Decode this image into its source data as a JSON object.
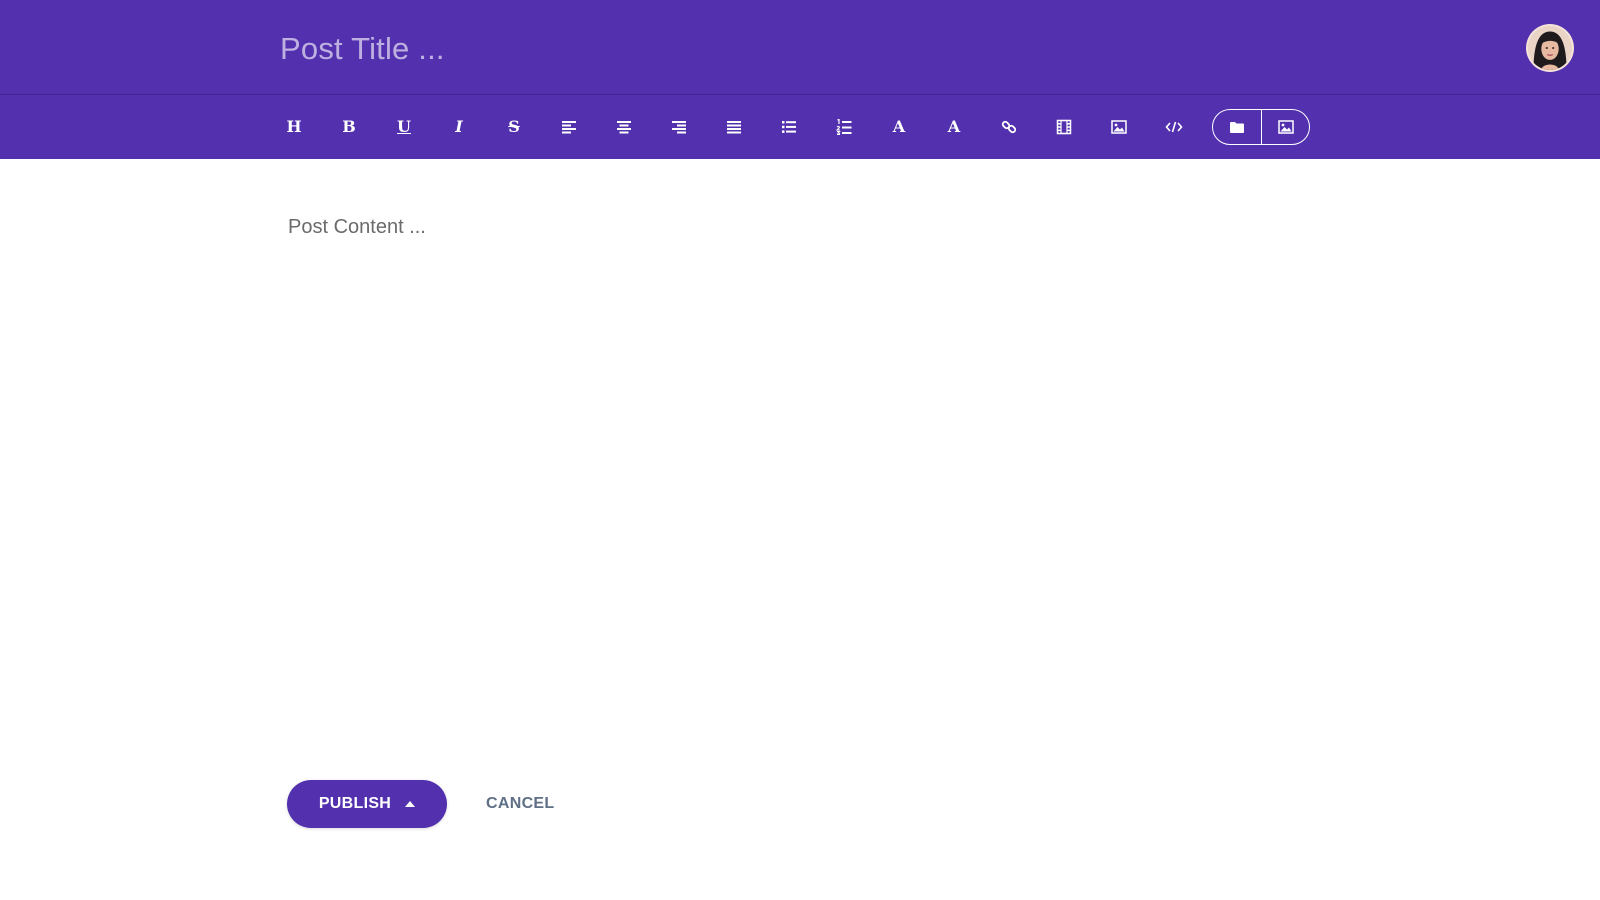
{
  "editor": {
    "title_placeholder": "Post Title ...",
    "content_placeholder": "Post Content ..."
  },
  "toolbar": {
    "heading": "H",
    "bold": "B",
    "underline": "U",
    "italic": "I",
    "strikethrough": "S",
    "font_color": "A",
    "highlight": "A",
    "icons": [
      "heading-icon",
      "bold-icon",
      "underline-icon",
      "italic-icon",
      "strikethrough-icon",
      "align-left-icon",
      "align-center-icon",
      "align-right-icon",
      "align-justify-icon",
      "bullet-list-icon",
      "numbered-list-icon",
      "font-color-icon",
      "highlight-icon",
      "link-icon",
      "video-icon",
      "image-icon",
      "code-icon",
      "folder-icon",
      "gallery-icon"
    ]
  },
  "actions": {
    "publish_label": "PUBLISH",
    "cancel_label": "CANCEL"
  },
  "colors": {
    "accent": "#5230ae",
    "cancel_text": "#5f6f86"
  }
}
